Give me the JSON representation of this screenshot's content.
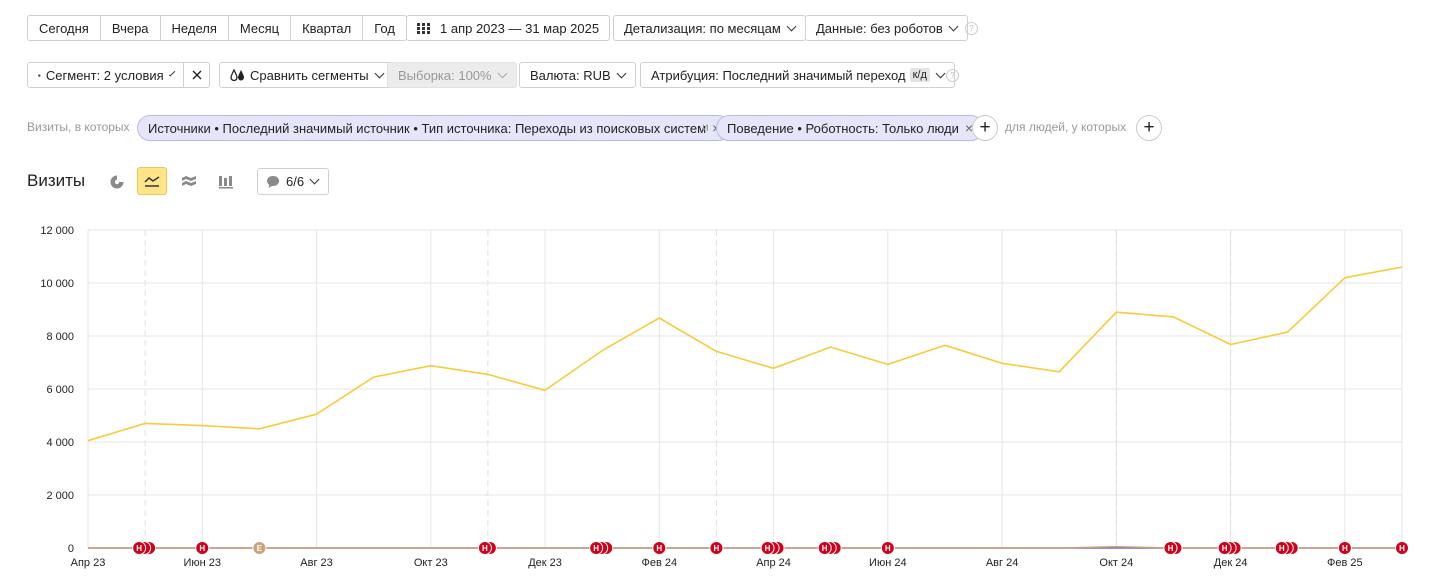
{
  "periods": [
    "Сегодня",
    "Вчера",
    "Неделя",
    "Месяц",
    "Квартал",
    "Год"
  ],
  "date_range": "1 апр 2023 — 31 мар 2025",
  "detail": "Детализация: по месяцам",
  "data_filter": "Данные: без роботов",
  "segment": "Сегмент: 2 условия",
  "compare": "Сравнить сегменты",
  "sample": "Выборка: 100%",
  "currency": "Валюта: RUB",
  "attribution": "Атрибуция: Последний значимый переход",
  "attribution_badge": "к/д",
  "filter_prefix": "Визиты, в которых",
  "chip1": "Источники • Последний значимый источник • Тип источника: Переходы из поисковых систем",
  "and_label": "и",
  "chip2": "Поведение • Роботность: Только люди",
  "people_label": "для людей, у которых",
  "section_title": "Визиты",
  "annotations_count": "6/6",
  "help_glyph": "?",
  "chart_data": {
    "type": "line",
    "ylim": [
      0,
      12000
    ],
    "yticks": [
      0,
      2000,
      4000,
      6000,
      8000,
      10000,
      12000
    ],
    "ytick_labels": [
      "0",
      "2 000",
      "4 000",
      "6 000",
      "8 000",
      "10 000",
      "12 000"
    ],
    "categories": [
      "Апр 23",
      "Май 23",
      "Июн 23",
      "Июл 23",
      "Авг 23",
      "Сен 23",
      "Окт 23",
      "Ноя 23",
      "Дек 23",
      "Янв 24",
      "Фев 24",
      "Мар 24",
      "Апр 24",
      "Май 24",
      "Июн 24",
      "Июл 24",
      "Авг 24",
      "Сен 24",
      "Окт 24",
      "Ноя 24",
      "Дек 24",
      "Янв 25",
      "Фев 25",
      "Мар 25"
    ],
    "xtick_labels": [
      "Апр 23",
      "Июн 23",
      "Авг 23",
      "Окт 23",
      "Дек 23",
      "Фев 24",
      "Апр 24",
      "Июн 24",
      "Авг 24",
      "Окт 24",
      "Дек 24",
      "Фев 25"
    ],
    "series": [
      {
        "color": "#f7cc3c",
        "values": [
          4050,
          4700,
          4620,
          4500,
          5050,
          6450,
          6880,
          6550,
          5950,
          7450,
          8680,
          7420,
          6780,
          7580,
          6930,
          7650,
          6970,
          6650,
          8900,
          8720,
          7680,
          8150,
          10200,
          10600
        ]
      },
      {
        "color": "#8a60c8",
        "values": [
          0,
          0,
          0,
          0,
          0,
          0,
          0,
          0,
          0,
          0,
          0,
          0,
          0,
          0,
          0,
          0,
          0,
          0,
          0,
          0,
          0,
          0,
          0,
          0
        ]
      },
      {
        "color": "#c9a27a",
        "values": [
          0,
          0,
          0,
          0,
          0,
          0,
          0,
          0,
          0,
          0,
          0,
          0,
          0,
          0,
          0,
          0,
          0,
          0,
          50,
          0,
          0,
          0,
          0,
          0
        ]
      }
    ],
    "markers": [
      {
        "x": 1,
        "count": 3,
        "label": "Н"
      },
      {
        "x": 2,
        "count": 1,
        "label": "Н"
      },
      {
        "x": 3,
        "count": 1,
        "label": "Е",
        "color": "#c9a27a"
      },
      {
        "x": 7,
        "count": 2,
        "label": "Н"
      },
      {
        "x": 9,
        "count": 3,
        "label": "Н"
      },
      {
        "x": 10,
        "count": 1,
        "label": "Н"
      },
      {
        "x": 11,
        "count": 1,
        "label": "Н"
      },
      {
        "x": 12,
        "count": 3,
        "label": "Н"
      },
      {
        "x": 13,
        "count": 3,
        "label": "Н"
      },
      {
        "x": 14,
        "count": 1,
        "label": "Н"
      },
      {
        "x": 19,
        "count": 2,
        "label": "Н"
      },
      {
        "x": 20,
        "count": 3,
        "label": "Н"
      },
      {
        "x": 21,
        "count": 3,
        "label": "Н"
      },
      {
        "x": 22,
        "count": 1,
        "label": "Н"
      },
      {
        "x": 23,
        "count": 1,
        "label": "Н"
      }
    ],
    "dashed_x": [
      1,
      7,
      11,
      18,
      20
    ]
  }
}
